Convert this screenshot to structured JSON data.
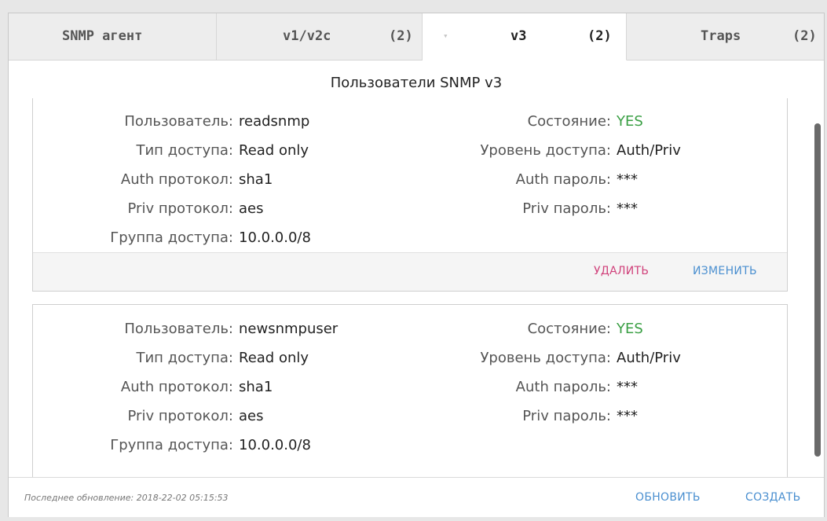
{
  "tabs": [
    {
      "label": "SNMP агент",
      "count": ""
    },
    {
      "label": "v1/v2c",
      "count": "(2)"
    },
    {
      "label": "v3",
      "count": "(2)",
      "caret": "▾"
    },
    {
      "label": "Traps",
      "count": "(2)"
    }
  ],
  "section_title": "Пользователи SNMP v3",
  "labels": {
    "user": "Пользователь:",
    "access_type": "Тип доступа:",
    "auth_protocol": "Auth протокол:",
    "priv_protocol": "Priv протокол:",
    "access_group": "Группа доступа:",
    "state": "Состояние:",
    "access_level": "Уровень доступа:",
    "auth_password": "Auth пароль:",
    "priv_password": "Priv пароль:"
  },
  "users": [
    {
      "user": "readsnmp",
      "access_type": "Read only",
      "auth_protocol": "sha1",
      "priv_protocol": "aes",
      "access_group": "10.0.0.0/8",
      "state": "YES",
      "access_level": "Auth/Priv",
      "auth_password": "***",
      "priv_password": "***",
      "delete_label": "УДАЛИТЬ",
      "edit_label": "ИЗМЕНИТЬ"
    },
    {
      "user": "newsnmpuser",
      "access_type": "Read only",
      "auth_protocol": "sha1",
      "priv_protocol": "aes",
      "access_group": "10.0.0.0/8",
      "state": "YES",
      "access_level": "Auth/Priv",
      "auth_password": "***",
      "priv_password": "***"
    }
  ],
  "footer": {
    "last_updated": "Последнее обновление: 2018-22-02 05:15:53",
    "refresh_label": "ОБНОВИТЬ",
    "create_label": "СОЗДАТЬ"
  },
  "colors": {
    "accent": "#4a8fd0",
    "delete": "#d0407a",
    "status_yes": "#3a9f44"
  }
}
